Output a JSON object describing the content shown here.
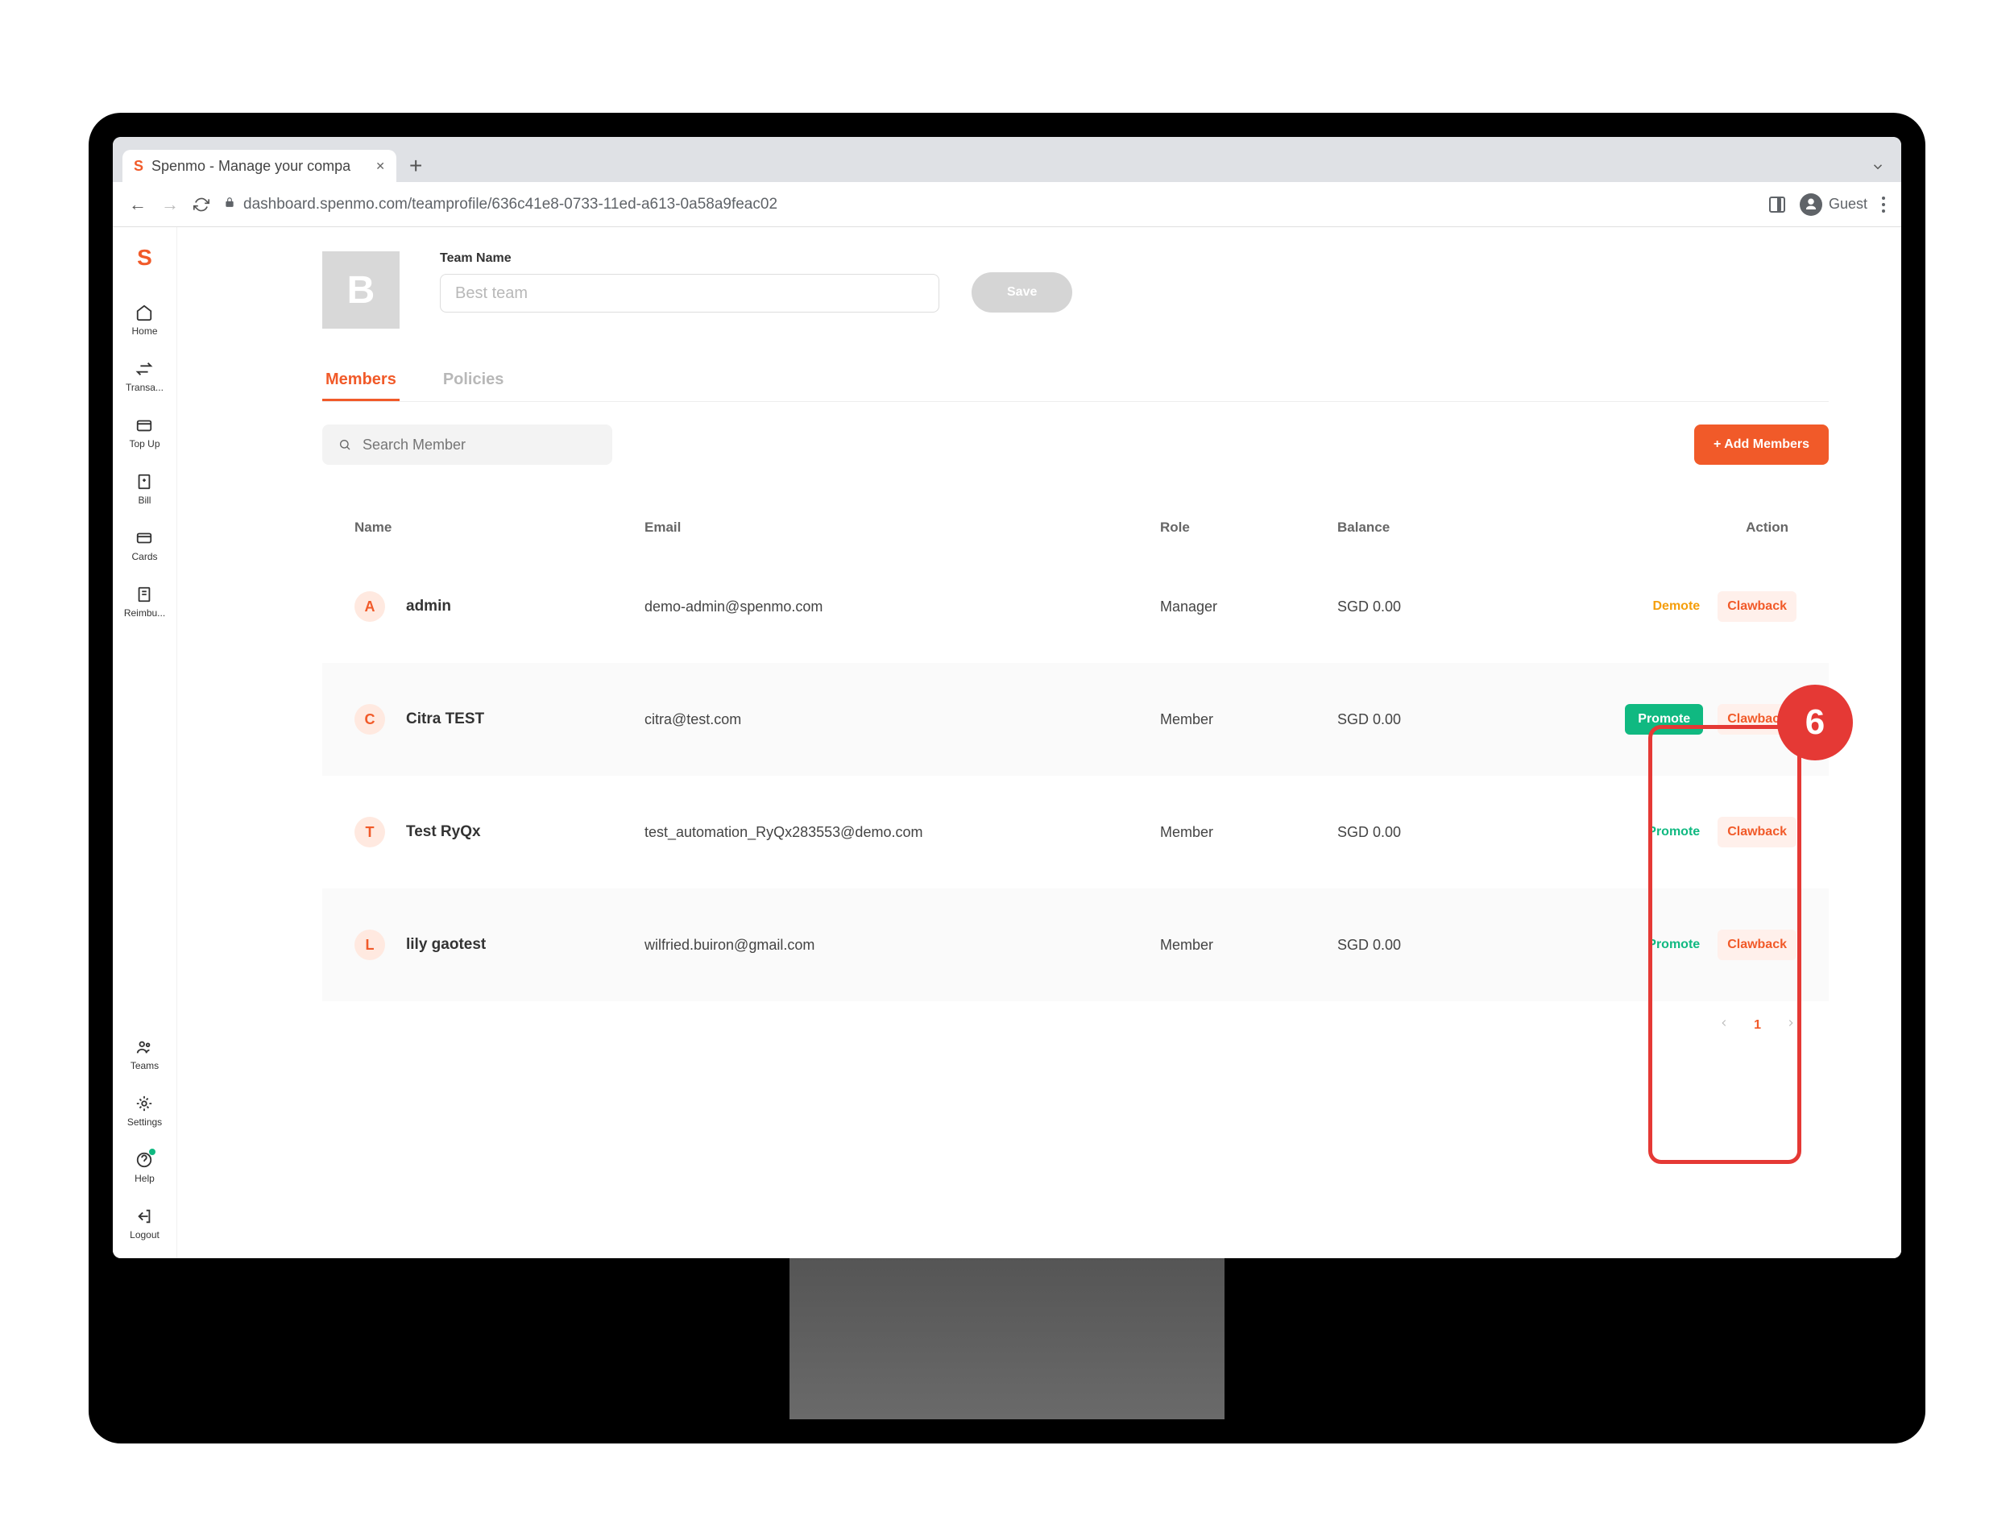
{
  "browser": {
    "tab_title": "Spenmo - Manage your compa",
    "url": "dashboard.spenmo.com/teamprofile/636c41e8-0733-11ed-a613-0a58a9feac02",
    "guest_label": "Guest"
  },
  "sidebar": {
    "items": [
      {
        "label": "Home"
      },
      {
        "label": "Transa..."
      },
      {
        "label": "Top Up"
      },
      {
        "label": "Bill"
      },
      {
        "label": "Cards"
      },
      {
        "label": "Reimbu..."
      }
    ],
    "bottom": [
      {
        "label": "Teams"
      },
      {
        "label": "Settings"
      },
      {
        "label": "Help"
      },
      {
        "label": "Logout"
      }
    ]
  },
  "team": {
    "avatar_letter": "B",
    "name_label": "Team Name",
    "name_value": "Best team",
    "save_label": "Save"
  },
  "tabs": {
    "members": "Members",
    "policies": "Policies"
  },
  "search": {
    "placeholder": "Search Member"
  },
  "add_button": "+ Add Members",
  "table": {
    "headers": {
      "name": "Name",
      "email": "Email",
      "role": "Role",
      "balance": "Balance",
      "action": "Action"
    },
    "rows": [
      {
        "initial": "A",
        "name": "admin",
        "email": "demo-admin@spenmo.com",
        "role": "Manager",
        "balance": "SGD 0.00",
        "primary_action": "Demote",
        "primary_style": "demote",
        "secondary_action": "Clawback"
      },
      {
        "initial": "C",
        "name": "Citra TEST",
        "email": "citra@test.com",
        "role": "Member",
        "balance": "SGD 0.00",
        "primary_action": "Promote",
        "primary_style": "promote-solid",
        "secondary_action": "Clawback"
      },
      {
        "initial": "T",
        "name": "Test RyQx",
        "email": "test_automation_RyQx283553@demo.com",
        "role": "Member",
        "balance": "SGD 0.00",
        "primary_action": "Promote",
        "primary_style": "promote",
        "secondary_action": "Clawback"
      },
      {
        "initial": "L",
        "name": "lily gaotest",
        "email": "wilfried.buiron@gmail.com",
        "role": "Member",
        "balance": "SGD 0.00",
        "primary_action": "Promote",
        "primary_style": "promote",
        "secondary_action": "Clawback"
      }
    ]
  },
  "pagination": {
    "current": "1"
  },
  "callout": {
    "number": "6"
  }
}
